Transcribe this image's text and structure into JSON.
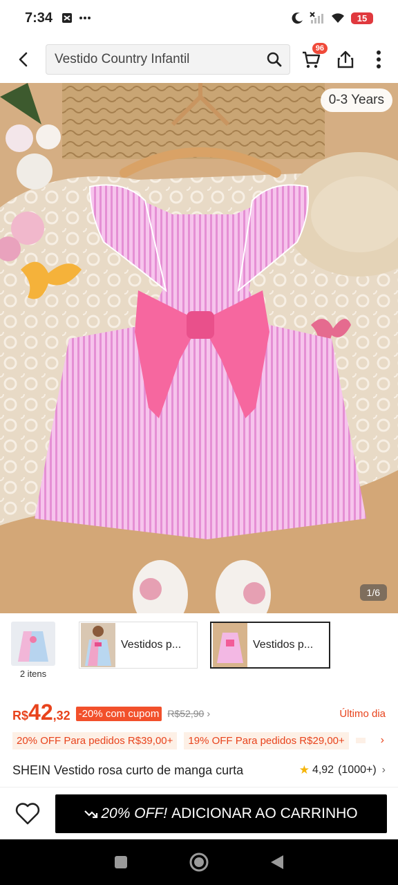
{
  "status_bar": {
    "time": "7:34",
    "battery": "15"
  },
  "search": {
    "query": "Vestido Country Infantil",
    "cart_count": "96"
  },
  "product_image": {
    "age_badge": "0-3 Years",
    "counter": "1/6"
  },
  "variants": {
    "all_count": "2 itens",
    "items": [
      {
        "label": "Vestidos p..."
      },
      {
        "label": "Vestidos p..."
      }
    ]
  },
  "price": {
    "currency": "R$",
    "integer": "42",
    "decimal": ",32",
    "coupon": "-20% com cupom",
    "original": "R$52,90",
    "deadline": "Último dia"
  },
  "promotions": [
    "20% OFF Para pedidos R$39,00+",
    "19% OFF Para pedidos R$29,00+"
  ],
  "product": {
    "title": "SHEIN Vestido rosa curto de manga curta",
    "rating": "4,92",
    "rating_count": "(1000+)"
  },
  "actions": {
    "discount": "20% OFF!",
    "add_to_cart": "ADICIONAR AO CARRINHO"
  },
  "colors": {
    "accent": "#e8431c",
    "coupon_bg": "#f2502b",
    "button_bg": "#000000"
  }
}
